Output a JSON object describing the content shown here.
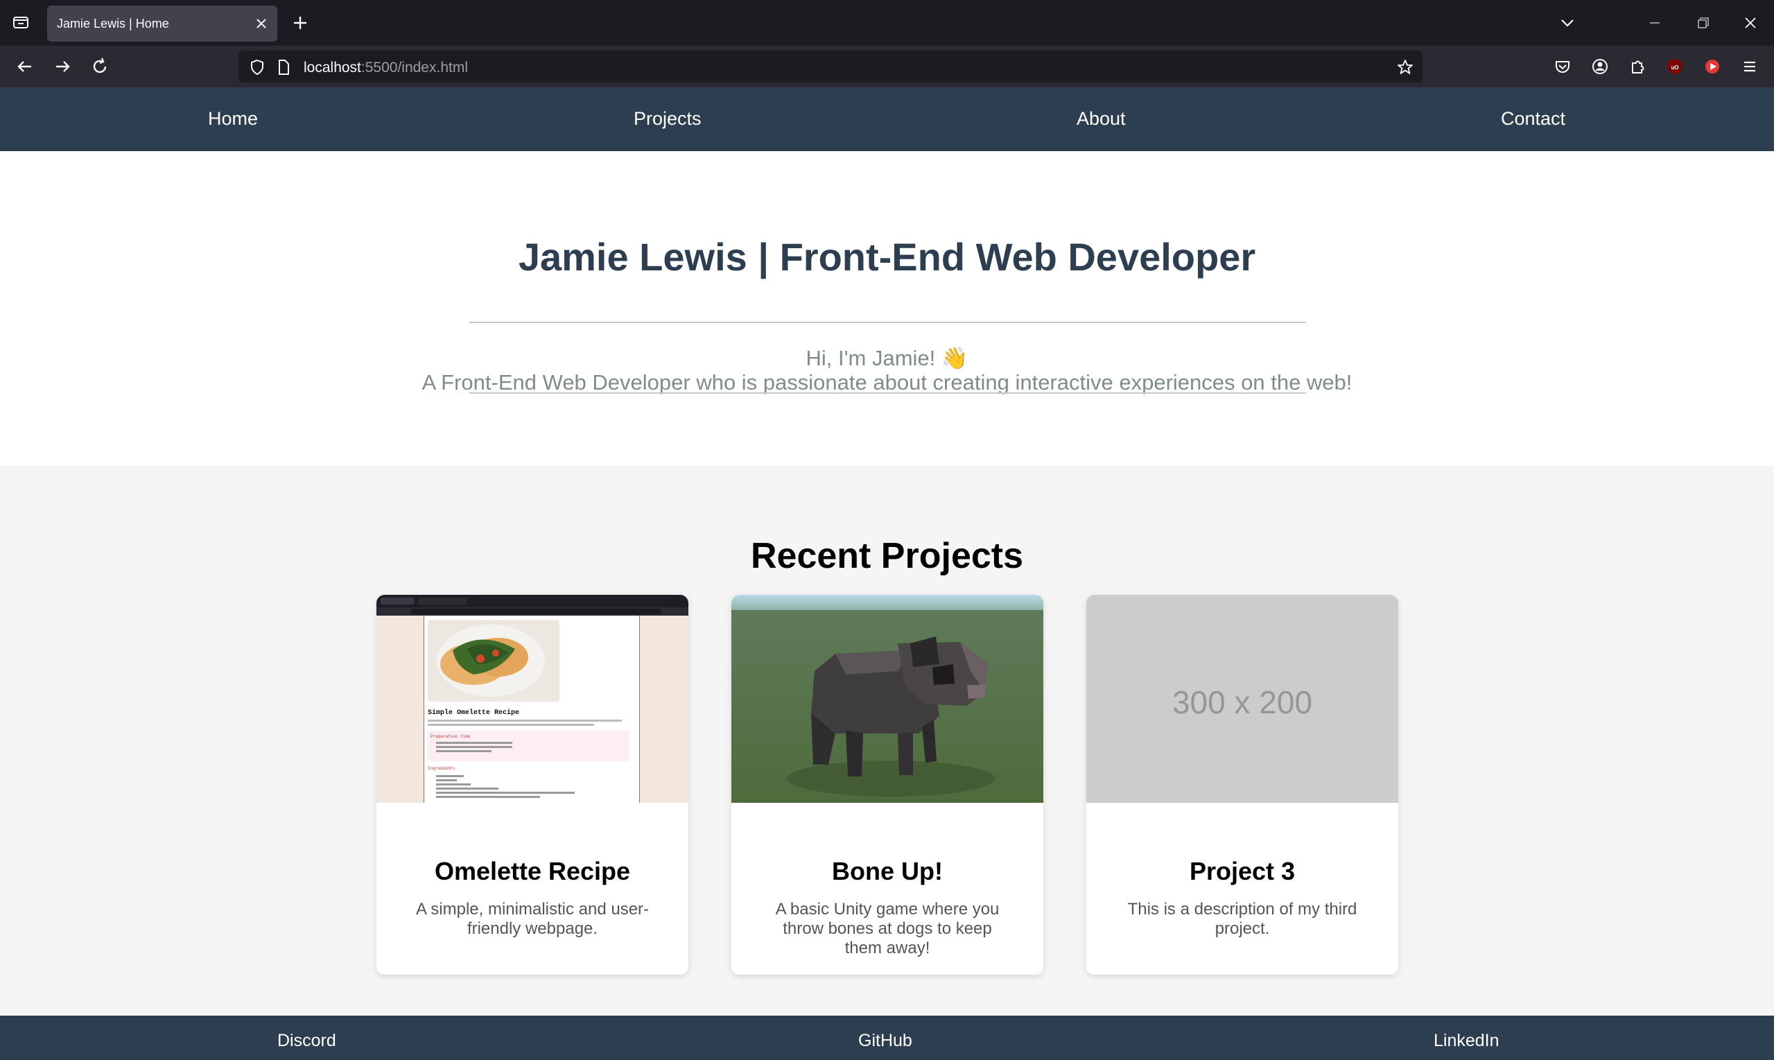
{
  "browser": {
    "tab_title": "Jamie Lewis | Home",
    "url_host": "localhost",
    "url_rest": ":5500/index.html"
  },
  "site": {
    "nav": [
      "Home",
      "Projects",
      "About",
      "Contact"
    ],
    "title": "Jamie Lewis | Front-End Web Developer",
    "greeting": "Hi, I'm Jamie! 👋",
    "tagline": "A Front-End Web Developer who is passionate about creating interactive experiences on the web!",
    "projects_heading": "Recent Projects",
    "projects": [
      {
        "title": "Omelette Recipe",
        "description": "A simple, minimalistic and user-friendly webpage.",
        "image": "omelette-recipe-screenshot"
      },
      {
        "title": "Bone Up!",
        "description": "A basic Unity game where you throw bones at dogs to keep them away!",
        "image": "low-poly-dog-game-screenshot"
      },
      {
        "title": "Project 3",
        "description": "This is a description of my third project.",
        "image_placeholder": "300 x 200"
      }
    ],
    "footer": [
      "Discord",
      "GitHub",
      "LinkedIn"
    ],
    "thumb_recipe": {
      "title": "Simple Omelette Recipe",
      "prep_heading": "Preparation time",
      "ingredients_heading": "Ingredients"
    }
  },
  "colors": {
    "nav_bg": "#2c3e50",
    "title": "#2c3e50",
    "muted_text": "#7f8c8d",
    "section_bg": "#f5f5f5"
  }
}
